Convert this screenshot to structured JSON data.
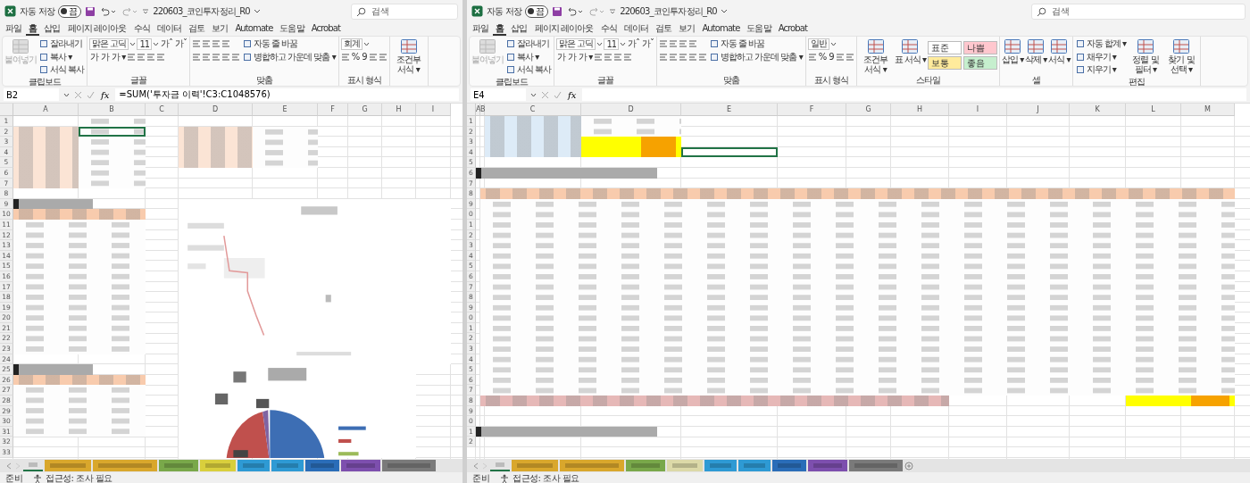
{
  "windows": [
    {
      "autosave": {
        "label": "자동 저장",
        "on": false,
        "state": "끔"
      },
      "file_name": "220603_코인투자정리_R0",
      "search": {
        "placeholder": "검색"
      },
      "menu": [
        {
          "label": "파일",
          "selected": false
        },
        {
          "label": "홈",
          "selected": true
        },
        {
          "label": "삽입",
          "selected": false
        },
        {
          "label": "페이지 레이아웃",
          "selected": false
        },
        {
          "label": "수식",
          "selected": false
        },
        {
          "label": "데이터",
          "selected": false
        },
        {
          "label": "검토",
          "selected": false
        },
        {
          "label": "보기",
          "selected": false
        },
        {
          "label": "Automate",
          "selected": false
        },
        {
          "label": "도움말",
          "selected": false
        },
        {
          "label": "Acrobat",
          "selected": false
        }
      ],
      "ribbon": [
        {
          "label": "클립보드",
          "items": [
            {
              "kind": "big",
              "text": "붙여넣기",
              "disabled": true
            },
            {
              "kind": "stack",
              "lines": [
                {
                  "items": [
                    {
                      "kind": "small",
                      "text": "잘라내기"
                    }
                  ]
                },
                {
                  "items": [
                    {
                      "kind": "small",
                      "text": "복사 ▾"
                    }
                  ]
                },
                {
                  "items": [
                    {
                      "kind": "small",
                      "text": "서식 복사"
                    }
                  ]
                }
              ]
            }
          ]
        },
        {
          "label": "글꼴",
          "items": [
            {
              "kind": "stack",
              "lines": [
                {
                  "items": [
                    {
                      "kind": "field",
                      "value": "맑은 고딕"
                    },
                    {
                      "kind": "field",
                      "value": "11"
                    },
                    {
                      "kind": "glyph",
                      "text": "가ˆ"
                    },
                    {
                      "kind": "glyph",
                      "text": "가ˇ"
                    }
                  ]
                },
                {
                  "items": [
                    {
                      "kind": "glyph",
                      "text": "가"
                    },
                    {
                      "kind": "glyph",
                      "text": "가"
                    },
                    {
                      "kind": "glyph",
                      "text": "가 ▾"
                    },
                    {
                      "kind": "icon"
                    },
                    {
                      "kind": "icon"
                    },
                    {
                      "kind": "icon"
                    },
                    {
                      "kind": "icon"
                    }
                  ]
                }
              ]
            }
          ]
        },
        {
          "label": "맞춤",
          "items": [
            {
              "kind": "stack",
              "lines": [
                {
                  "items": [
                    {
                      "kind": "icon"
                    },
                    {
                      "kind": "icon"
                    },
                    {
                      "kind": "icon"
                    },
                    {
                      "kind": "icon"
                    }
                  ]
                },
                {
                  "items": [
                    {
                      "kind": "icon"
                    },
                    {
                      "kind": "icon"
                    },
                    {
                      "kind": "icon"
                    },
                    {
                      "kind": "icon"
                    },
                    {
                      "kind": "icon"
                    }
                  ]
                }
              ]
            },
            {
              "kind": "stack",
              "lines": [
                {
                  "items": [
                    {
                      "kind": "small",
                      "text": "자동 줄 바꿈"
                    }
                  ]
                },
                {
                  "items": [
                    {
                      "kind": "small",
                      "text": "병합하고 가운데 맞춤 ▾"
                    }
                  ]
                }
              ]
            }
          ]
        },
        {
          "label": "표시 형식",
          "items": [
            {
              "kind": "stack",
              "lines": [
                {
                  "items": [
                    {
                      "kind": "field",
                      "value": "회계"
                    }
                  ]
                },
                {
                  "items": [
                    {
                      "kind": "icon"
                    },
                    {
                      "kind": "glyph",
                      "text": "%"
                    },
                    {
                      "kind": "glyph",
                      "text": "9"
                    },
                    {
                      "kind": "icon"
                    },
                    {
                      "kind": "icon"
                    }
                  ]
                }
              ]
            }
          ]
        },
        {
          "items": [
            {
              "kind": "big",
              "text": "조건부 서식 ▾",
              "disabled": false
            }
          ]
        }
      ],
      "name_box": "B2",
      "function_label": "fx",
      "formula": "=SUM('투자금 이력'!C3:C1048576)",
      "columns": [
        "A",
        "B",
        "C",
        "D",
        "E",
        "F",
        "G",
        "H",
        "I"
      ],
      "rows": [
        "1",
        "2",
        "3",
        "4",
        "5",
        "6",
        "7",
        "8",
        "9",
        "10",
        "11",
        "12",
        "13",
        "14",
        "15",
        "16",
        "17",
        "18",
        "19",
        "20",
        "21",
        "22",
        "23",
        "24",
        "25",
        "26",
        "27",
        "28",
        "29",
        "30",
        "31",
        "32",
        "33"
      ],
      "sheet_tabs": [
        {
          "color": "#e4e4e4",
          "selected": true
        },
        {
          "color": "#d9a72c",
          "selected": false
        },
        {
          "color": "#d9a72c",
          "selected": false
        },
        {
          "color": "#79a84a",
          "selected": false
        },
        {
          "color": "#d9cf3c",
          "selected": false
        },
        {
          "color": "#2e9ad4",
          "selected": false
        },
        {
          "color": "#2e9ad4",
          "selected": false
        },
        {
          "color": "#2a6db8",
          "selected": false
        },
        {
          "color": "#7d4fae",
          "selected": false
        },
        {
          "color": "#7a7a7a",
          "selected": false
        }
      ],
      "status": [
        "준비",
        "접근성: 조사 필요"
      ]
    },
    {
      "autosave": {
        "label": "자동 저장",
        "on": false,
        "state": "끔"
      },
      "file_name": "220603_코인투자정리_R0",
      "search": {
        "placeholder": "검색"
      },
      "menu": [
        {
          "label": "파일",
          "selected": false
        },
        {
          "label": "홈",
          "selected": true
        },
        {
          "label": "삽입",
          "selected": false
        },
        {
          "label": "페이지 레이아웃",
          "selected": false
        },
        {
          "label": "수식",
          "selected": false
        },
        {
          "label": "데이터",
          "selected": false
        },
        {
          "label": "검토",
          "selected": false
        },
        {
          "label": "보기",
          "selected": false
        },
        {
          "label": "Automate",
          "selected": false
        },
        {
          "label": "도움말",
          "selected": false
        },
        {
          "label": "Acrobat",
          "selected": false
        }
      ],
      "ribbon": [
        {
          "label": "클립보드",
          "items": [
            {
              "kind": "big",
              "text": "붙여넣기",
              "disabled": true
            },
            {
              "kind": "stack",
              "lines": [
                {
                  "items": [
                    {
                      "kind": "small",
                      "text": "잘라내기"
                    }
                  ]
                },
                {
                  "items": [
                    {
                      "kind": "small",
                      "text": "복사 ▾"
                    }
                  ]
                },
                {
                  "items": [
                    {
                      "kind": "small",
                      "text": "서식 복사"
                    }
                  ]
                }
              ]
            }
          ]
        },
        {
          "label": "글꼴",
          "items": [
            {
              "kind": "stack",
              "lines": [
                {
                  "items": [
                    {
                      "kind": "field",
                      "value": "맑은 고딕"
                    },
                    {
                      "kind": "field",
                      "value": "11"
                    },
                    {
                      "kind": "glyph",
                      "text": "가ˆ"
                    },
                    {
                      "kind": "glyph",
                      "text": "가ˇ"
                    }
                  ]
                },
                {
                  "items": [
                    {
                      "kind": "glyph",
                      "text": "가"
                    },
                    {
                      "kind": "glyph",
                      "text": "가"
                    },
                    {
                      "kind": "glyph",
                      "text": "가 ▾"
                    },
                    {
                      "kind": "icon"
                    },
                    {
                      "kind": "icon"
                    },
                    {
                      "kind": "icon"
                    },
                    {
                      "kind": "icon"
                    }
                  ]
                }
              ]
            }
          ]
        },
        {
          "label": "맞춤",
          "items": [
            {
              "kind": "stack",
              "lines": [
                {
                  "items": [
                    {
                      "kind": "icon"
                    },
                    {
                      "kind": "icon"
                    },
                    {
                      "kind": "icon"
                    },
                    {
                      "kind": "icon"
                    }
                  ]
                },
                {
                  "items": [
                    {
                      "kind": "icon"
                    },
                    {
                      "kind": "icon"
                    },
                    {
                      "kind": "icon"
                    },
                    {
                      "kind": "icon"
                    },
                    {
                      "kind": "icon"
                    }
                  ]
                }
              ]
            },
            {
              "kind": "stack",
              "lines": [
                {
                  "items": [
                    {
                      "kind": "small",
                      "text": "자동 줄 바꿈"
                    }
                  ]
                },
                {
                  "items": [
                    {
                      "kind": "small",
                      "text": "병합하고 가운데 맞춤 ▾"
                    }
                  ]
                }
              ]
            }
          ]
        },
        {
          "label": "표시 형식",
          "items": [
            {
              "kind": "stack",
              "lines": [
                {
                  "items": [
                    {
                      "kind": "field",
                      "value": "일반"
                    }
                  ]
                },
                {
                  "items": [
                    {
                      "kind": "icon"
                    },
                    {
                      "kind": "glyph",
                      "text": "%"
                    },
                    {
                      "kind": "glyph",
                      "text": "9"
                    },
                    {
                      "kind": "icon"
                    },
                    {
                      "kind": "icon"
                    }
                  ]
                }
              ]
            }
          ]
        },
        {
          "label": "스타일",
          "items": [
            {
              "kind": "big",
              "text": "조건부 서식 ▾",
              "disabled": false
            },
            {
              "kind": "big",
              "text": "표 서식 ▾",
              "disabled": false
            },
            {
              "kind": "styles",
              "cells": [
                {
                  "text": "표준",
                  "color": "#ffffff"
                },
                {
                  "text": "나쁨",
                  "color": "#ffc7ce"
                },
                {
                  "text": "보통",
                  "color": "#ffeb9c"
                },
                {
                  "text": "좋음",
                  "color": "#c6efce"
                }
              ]
            }
          ]
        },
        {
          "label": "셀",
          "items": [
            {
              "kind": "big",
              "text": "삽입 ▾",
              "disabled": false
            },
            {
              "kind": "big",
              "text": "삭제 ▾",
              "disabled": false
            },
            {
              "kind": "big",
              "text": "서식 ▾",
              "disabled": false
            }
          ]
        },
        {
          "label": "편집",
          "items": [
            {
              "kind": "stack",
              "lines": [
                {
                  "items": [
                    {
                      "kind": "small",
                      "text": "자동 합계 ▾"
                    }
                  ]
                },
                {
                  "items": [
                    {
                      "kind": "small",
                      "text": "채우기 ▾"
                    }
                  ]
                },
                {
                  "items": [
                    {
                      "kind": "small",
                      "text": "지우기 ▾"
                    }
                  ]
                }
              ]
            },
            {
              "kind": "big",
              "text": "정렬 및 필터 ▾",
              "disabled": false
            },
            {
              "kind": "big",
              "text": "찾기 및 선택 ▾",
              "disabled": false
            }
          ]
        }
      ],
      "name_box": "E4",
      "function_label": "fx",
      "columns": [
        "A",
        "B",
        "C",
        "D",
        "E",
        "F",
        "G",
        "H",
        "I",
        "J",
        "K",
        "L",
        "M"
      ],
      "rows": [
        "1",
        "2",
        "3",
        "4",
        "5",
        "6",
        "7",
        "8",
        "9",
        "0",
        "1",
        "2",
        "3",
        "4",
        "5",
        "6",
        "7",
        "8",
        "9",
        "0",
        "1",
        "2",
        "3",
        "4",
        "5",
        "6",
        "7",
        "8",
        "9",
        "0",
        "1",
        "2"
      ],
      "sheet_tabs": [
        {
          "color": "#e4e4e4",
          "selected": true
        },
        {
          "color": "#d9a72c",
          "selected": false
        },
        {
          "color": "#d9a72c",
          "selected": false
        },
        {
          "color": "#79a84a",
          "selected": false
        },
        {
          "color": "#dcd9a8",
          "selected": false
        },
        {
          "color": "#2e9ad4",
          "selected": false
        },
        {
          "color": "#2e9ad4",
          "selected": false
        },
        {
          "color": "#2a6db8",
          "selected": false
        },
        {
          "color": "#7d4fae",
          "selected": false
        },
        {
          "color": "#7a7a7a",
          "selected": false
        }
      ],
      "add_sheet_button": true,
      "status": [
        "준비",
        "접근성: 조사 필요"
      ]
    }
  ]
}
